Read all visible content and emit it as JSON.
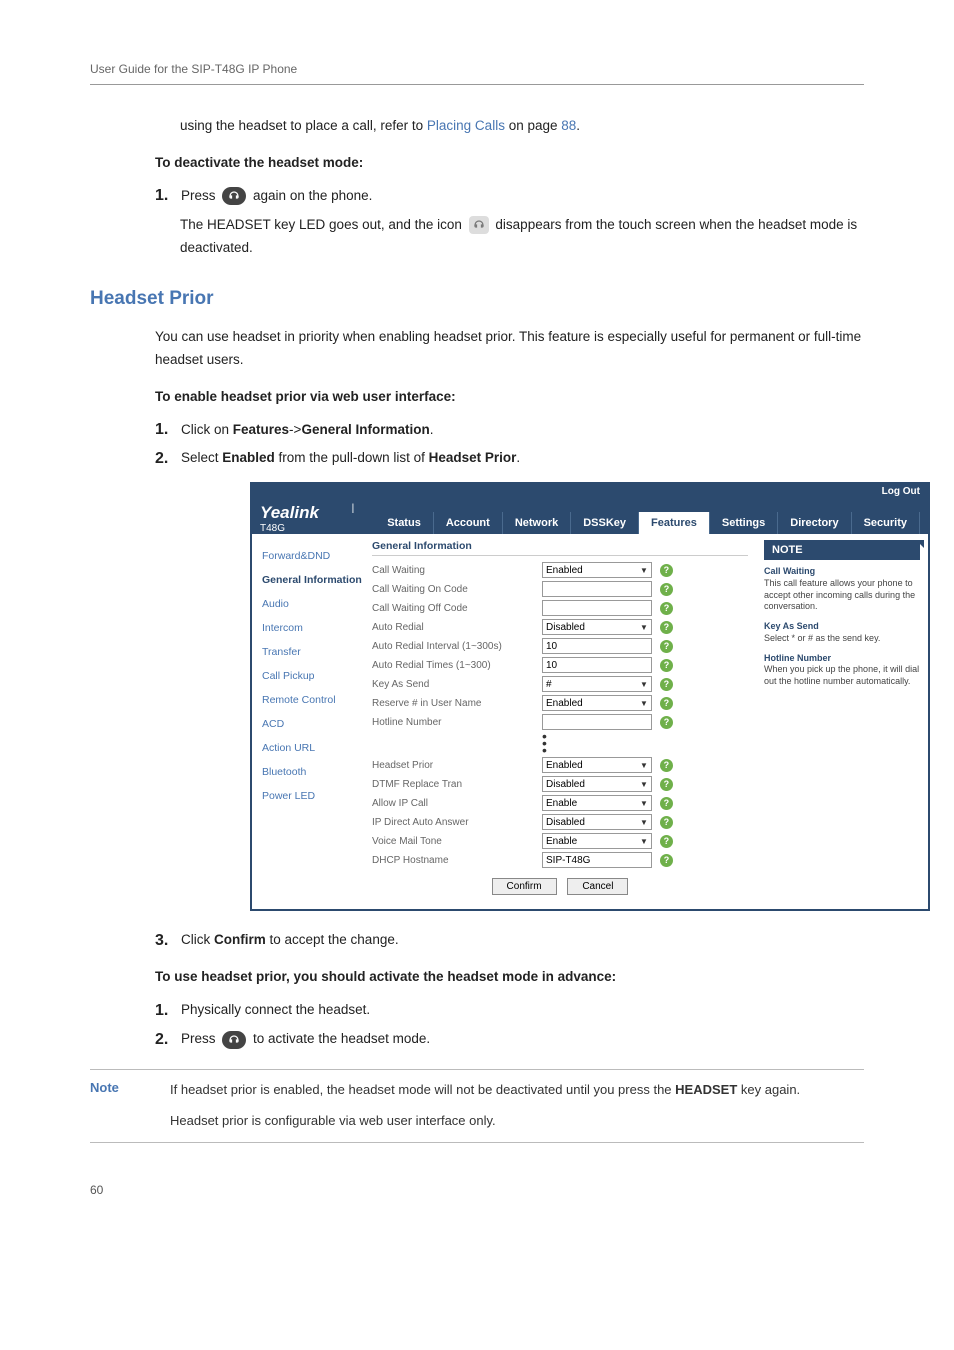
{
  "header": "User Guide for the SIP-T48G IP Phone",
  "intro_line_a": "using the headset to place a call, refer to ",
  "intro_link": "Placing Calls",
  "intro_line_b": " on page ",
  "intro_page": "88",
  "intro_line_c": ".",
  "deactivate_heading": "To deactivate the headset mode:",
  "step1_num": "1.",
  "step1_a": "Press ",
  "step1_b": " again on the phone.",
  "step1_desc_a": "The HEADSET key LED goes out, and the icon ",
  "step1_desc_b": " disappears from the touch screen when the headset mode is deactivated.",
  "section_heading": "Headset Prior",
  "section_para": "You can use headset in priority when enabling headset prior. This feature is especially useful for permanent or full-time headset users.",
  "enable_heading": "To enable headset prior via web user interface:",
  "estep1_num": "1.",
  "estep1_a": "Click on ",
  "estep1_b": "Features",
  "estep1_c": "->",
  "estep1_d": "General Information",
  "estep1_e": ".",
  "estep2_num": "2.",
  "estep2_a": "Select ",
  "estep2_b": "Enabled",
  "estep2_c": " from the pull-down list of ",
  "estep2_d": "Headset Prior",
  "estep2_e": ".",
  "estep3_num": "3.",
  "estep3_a": "Click ",
  "estep3_b": "Confirm",
  "estep3_c": " to accept the change.",
  "use_heading": "To use headset prior, you should activate the headset mode in advance:",
  "ustep1_num": "1.",
  "ustep1_text": "Physically connect the headset.",
  "ustep2_num": "2.",
  "ustep2_a": "Press ",
  "ustep2_b": " to activate the headset mode.",
  "note_label": "Note",
  "note_line1_a": "If headset prior is enabled, the headset mode will not be deactivated until you press the ",
  "note_line1_b": "HEADSET",
  "note_line1_c": " key again.",
  "note_line2": "Headset prior is configurable via web user interface only.",
  "page_number": "60",
  "ss": {
    "logout": "Log Out",
    "logo": "Yealink",
    "logo_model": " | T48G",
    "tabs": [
      "Status",
      "Account",
      "Network",
      "DSSKey",
      "Features",
      "Settings",
      "Directory",
      "Security"
    ],
    "active_tab": 4,
    "sidebar": [
      "Forward&DND",
      "General Information",
      "Audio",
      "Intercom",
      "Transfer",
      "Call Pickup",
      "Remote Control",
      "ACD",
      "Action URL",
      "Bluetooth",
      "Power LED"
    ],
    "active_side": 1,
    "group_title": "General Information",
    "rows1": [
      {
        "label": "Call Waiting",
        "type": "select",
        "value": "Enabled"
      },
      {
        "label": "Call Waiting On Code",
        "type": "text",
        "value": ""
      },
      {
        "label": "Call Waiting Off Code",
        "type": "text",
        "value": ""
      },
      {
        "label": "Auto Redial",
        "type": "select",
        "value": "Disabled"
      },
      {
        "label": "Auto Redial Interval (1~300s)",
        "type": "text",
        "value": "10"
      },
      {
        "label": "Auto Redial Times (1~300)",
        "type": "text",
        "value": "10"
      },
      {
        "label": "Key As Send",
        "type": "select",
        "value": "#"
      },
      {
        "label": "Reserve # in User Name",
        "type": "select",
        "value": "Enabled"
      },
      {
        "label": "Hotline Number",
        "type": "text",
        "value": ""
      }
    ],
    "rows2": [
      {
        "label": "Headset Prior",
        "type": "select",
        "value": "Enabled"
      },
      {
        "label": "DTMF Replace Tran",
        "type": "select",
        "value": "Disabled"
      },
      {
        "label": "Allow IP Call",
        "type": "select",
        "value": "Enable"
      },
      {
        "label": "IP Direct Auto Answer",
        "type": "select",
        "value": "Disabled"
      },
      {
        "label": "Voice Mail Tone",
        "type": "select",
        "value": "Enable"
      },
      {
        "label": "DHCP Hostname",
        "type": "text",
        "value": "SIP-T48G"
      }
    ],
    "confirm": "Confirm",
    "cancel": "Cancel",
    "note_head": "NOTE",
    "note_items": [
      {
        "title": "Call Waiting",
        "body": "This call feature allows your phone to accept other incoming calls during the conversation."
      },
      {
        "title": "Key As Send",
        "body": "Select * or # as the send key."
      },
      {
        "title": "Hotline Number",
        "body": "When you pick up the phone, it will dial out the hotline number automatically."
      }
    ]
  }
}
